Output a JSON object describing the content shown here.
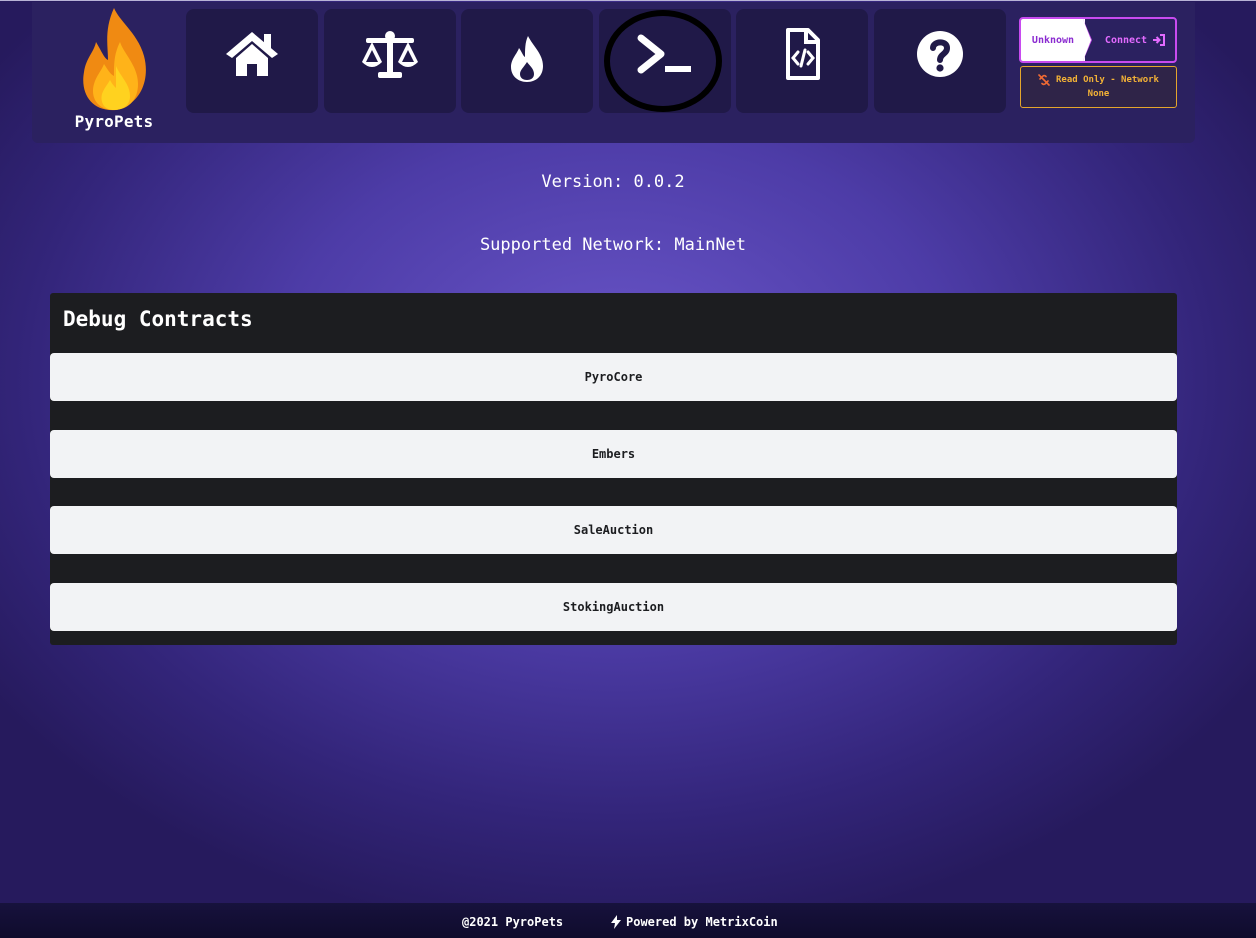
{
  "brand": {
    "name": "PyroPets",
    "logo_icon": "flame-logo"
  },
  "nav": {
    "items": [
      {
        "id": "home",
        "icon": "home-icon"
      },
      {
        "id": "scales",
        "icon": "scales-icon"
      },
      {
        "id": "fire",
        "icon": "fire-icon"
      },
      {
        "id": "debug",
        "icon": "terminal-icon"
      },
      {
        "id": "contract-docs",
        "icon": "file-code-icon"
      },
      {
        "id": "help",
        "icon": "question-icon"
      }
    ]
  },
  "wallet": {
    "status": "Unknown",
    "connect_label": "Connect",
    "network_line1": "Read Only - Network",
    "network_line2": "None"
  },
  "info": {
    "version": "Version: 0.0.2",
    "network": "Supported Network: MainNet"
  },
  "debug": {
    "title": "Debug Contracts",
    "contracts": [
      "PyroCore",
      "Embers",
      "SaleAuction",
      "StokingAuction"
    ]
  },
  "footer": {
    "copyright": "@2021 PyroPets",
    "powered": "Powered by MetrixCoin"
  },
  "colors": {
    "accent_purple": "#c84bf0",
    "warning_orange": "#f3b236",
    "panel_dark": "#1c1d20"
  }
}
